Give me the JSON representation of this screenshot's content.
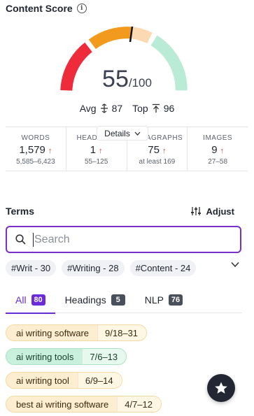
{
  "header": {
    "title": "Content Score",
    "info_icon": "info-icon"
  },
  "score": {
    "value": "55",
    "max": "/100",
    "fraction": 0.55
  },
  "benchmarks": {
    "avg_label": "Avg",
    "avg_value": "87",
    "top_label": "Top",
    "top_value": "96"
  },
  "colors": {
    "red": "#ee2b3b",
    "orange": "#f29a1e",
    "light_orange": "#fbd9b2",
    "green": "#b9ebd6",
    "accent": "#6c2bd9"
  },
  "stats": [
    {
      "label": "WORDS",
      "value": "1,579",
      "range": "5,585–6,423"
    },
    {
      "label": "HEADINGS",
      "value": "1",
      "range": "55–125"
    },
    {
      "label": "PARAGRAPHS",
      "value": "75",
      "range": "at least 169"
    },
    {
      "label": "IMAGES",
      "value": "9",
      "range": "27–58"
    }
  ],
  "details_button": "Details",
  "terms": {
    "title": "Terms",
    "adjust_label": "Adjust"
  },
  "search": {
    "placeholder": "Search",
    "value": ""
  },
  "chips": [
    "#Writ - 30",
    "#Writing - 28",
    "#Content - 24"
  ],
  "tabs": [
    {
      "label": "All",
      "count": "80",
      "active": true
    },
    {
      "label": "Headings",
      "count": "5",
      "active": false
    },
    {
      "label": "NLP",
      "count": "76",
      "active": false
    }
  ],
  "term_list": [
    {
      "name": "ai writing software",
      "count": "9/18–31",
      "status": "orange"
    },
    {
      "name": "ai writing tools",
      "count": "7/6–13",
      "status": "green"
    },
    {
      "name": "ai writing tool",
      "count": "6/9–14",
      "status": "orange"
    },
    {
      "name": "best ai writing software",
      "count": "4/7–12",
      "status": "orange"
    }
  ]
}
